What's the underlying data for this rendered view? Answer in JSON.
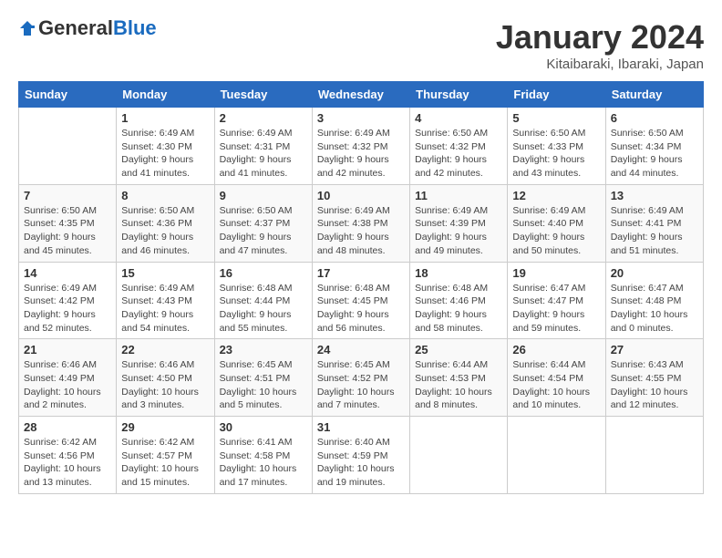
{
  "logo": {
    "general": "General",
    "blue": "Blue"
  },
  "title": "January 2024",
  "location": "Kitaibaraki, Ibaraki, Japan",
  "days_header": [
    "Sunday",
    "Monday",
    "Tuesday",
    "Wednesday",
    "Thursday",
    "Friday",
    "Saturday"
  ],
  "weeks": [
    [
      {
        "num": "",
        "data": ""
      },
      {
        "num": "1",
        "data": "Sunrise: 6:49 AM\nSunset: 4:30 PM\nDaylight: 9 hours\nand 41 minutes."
      },
      {
        "num": "2",
        "data": "Sunrise: 6:49 AM\nSunset: 4:31 PM\nDaylight: 9 hours\nand 41 minutes."
      },
      {
        "num": "3",
        "data": "Sunrise: 6:49 AM\nSunset: 4:32 PM\nDaylight: 9 hours\nand 42 minutes."
      },
      {
        "num": "4",
        "data": "Sunrise: 6:50 AM\nSunset: 4:32 PM\nDaylight: 9 hours\nand 42 minutes."
      },
      {
        "num": "5",
        "data": "Sunrise: 6:50 AM\nSunset: 4:33 PM\nDaylight: 9 hours\nand 43 minutes."
      },
      {
        "num": "6",
        "data": "Sunrise: 6:50 AM\nSunset: 4:34 PM\nDaylight: 9 hours\nand 44 minutes."
      }
    ],
    [
      {
        "num": "7",
        "data": "Sunrise: 6:50 AM\nSunset: 4:35 PM\nDaylight: 9 hours\nand 45 minutes."
      },
      {
        "num": "8",
        "data": "Sunrise: 6:50 AM\nSunset: 4:36 PM\nDaylight: 9 hours\nand 46 minutes."
      },
      {
        "num": "9",
        "data": "Sunrise: 6:50 AM\nSunset: 4:37 PM\nDaylight: 9 hours\nand 47 minutes."
      },
      {
        "num": "10",
        "data": "Sunrise: 6:49 AM\nSunset: 4:38 PM\nDaylight: 9 hours\nand 48 minutes."
      },
      {
        "num": "11",
        "data": "Sunrise: 6:49 AM\nSunset: 4:39 PM\nDaylight: 9 hours\nand 49 minutes."
      },
      {
        "num": "12",
        "data": "Sunrise: 6:49 AM\nSunset: 4:40 PM\nDaylight: 9 hours\nand 50 minutes."
      },
      {
        "num": "13",
        "data": "Sunrise: 6:49 AM\nSunset: 4:41 PM\nDaylight: 9 hours\nand 51 minutes."
      }
    ],
    [
      {
        "num": "14",
        "data": "Sunrise: 6:49 AM\nSunset: 4:42 PM\nDaylight: 9 hours\nand 52 minutes."
      },
      {
        "num": "15",
        "data": "Sunrise: 6:49 AM\nSunset: 4:43 PM\nDaylight: 9 hours\nand 54 minutes."
      },
      {
        "num": "16",
        "data": "Sunrise: 6:48 AM\nSunset: 4:44 PM\nDaylight: 9 hours\nand 55 minutes."
      },
      {
        "num": "17",
        "data": "Sunrise: 6:48 AM\nSunset: 4:45 PM\nDaylight: 9 hours\nand 56 minutes."
      },
      {
        "num": "18",
        "data": "Sunrise: 6:48 AM\nSunset: 4:46 PM\nDaylight: 9 hours\nand 58 minutes."
      },
      {
        "num": "19",
        "data": "Sunrise: 6:47 AM\nSunset: 4:47 PM\nDaylight: 9 hours\nand 59 minutes."
      },
      {
        "num": "20",
        "data": "Sunrise: 6:47 AM\nSunset: 4:48 PM\nDaylight: 10 hours\nand 0 minutes."
      }
    ],
    [
      {
        "num": "21",
        "data": "Sunrise: 6:46 AM\nSunset: 4:49 PM\nDaylight: 10 hours\nand 2 minutes."
      },
      {
        "num": "22",
        "data": "Sunrise: 6:46 AM\nSunset: 4:50 PM\nDaylight: 10 hours\nand 3 minutes."
      },
      {
        "num": "23",
        "data": "Sunrise: 6:45 AM\nSunset: 4:51 PM\nDaylight: 10 hours\nand 5 minutes."
      },
      {
        "num": "24",
        "data": "Sunrise: 6:45 AM\nSunset: 4:52 PM\nDaylight: 10 hours\nand 7 minutes."
      },
      {
        "num": "25",
        "data": "Sunrise: 6:44 AM\nSunset: 4:53 PM\nDaylight: 10 hours\nand 8 minutes."
      },
      {
        "num": "26",
        "data": "Sunrise: 6:44 AM\nSunset: 4:54 PM\nDaylight: 10 hours\nand 10 minutes."
      },
      {
        "num": "27",
        "data": "Sunrise: 6:43 AM\nSunset: 4:55 PM\nDaylight: 10 hours\nand 12 minutes."
      }
    ],
    [
      {
        "num": "28",
        "data": "Sunrise: 6:42 AM\nSunset: 4:56 PM\nDaylight: 10 hours\nand 13 minutes."
      },
      {
        "num": "29",
        "data": "Sunrise: 6:42 AM\nSunset: 4:57 PM\nDaylight: 10 hours\nand 15 minutes."
      },
      {
        "num": "30",
        "data": "Sunrise: 6:41 AM\nSunset: 4:58 PM\nDaylight: 10 hours\nand 17 minutes."
      },
      {
        "num": "31",
        "data": "Sunrise: 6:40 AM\nSunset: 4:59 PM\nDaylight: 10 hours\nand 19 minutes."
      },
      {
        "num": "",
        "data": ""
      },
      {
        "num": "",
        "data": ""
      },
      {
        "num": "",
        "data": ""
      }
    ]
  ]
}
